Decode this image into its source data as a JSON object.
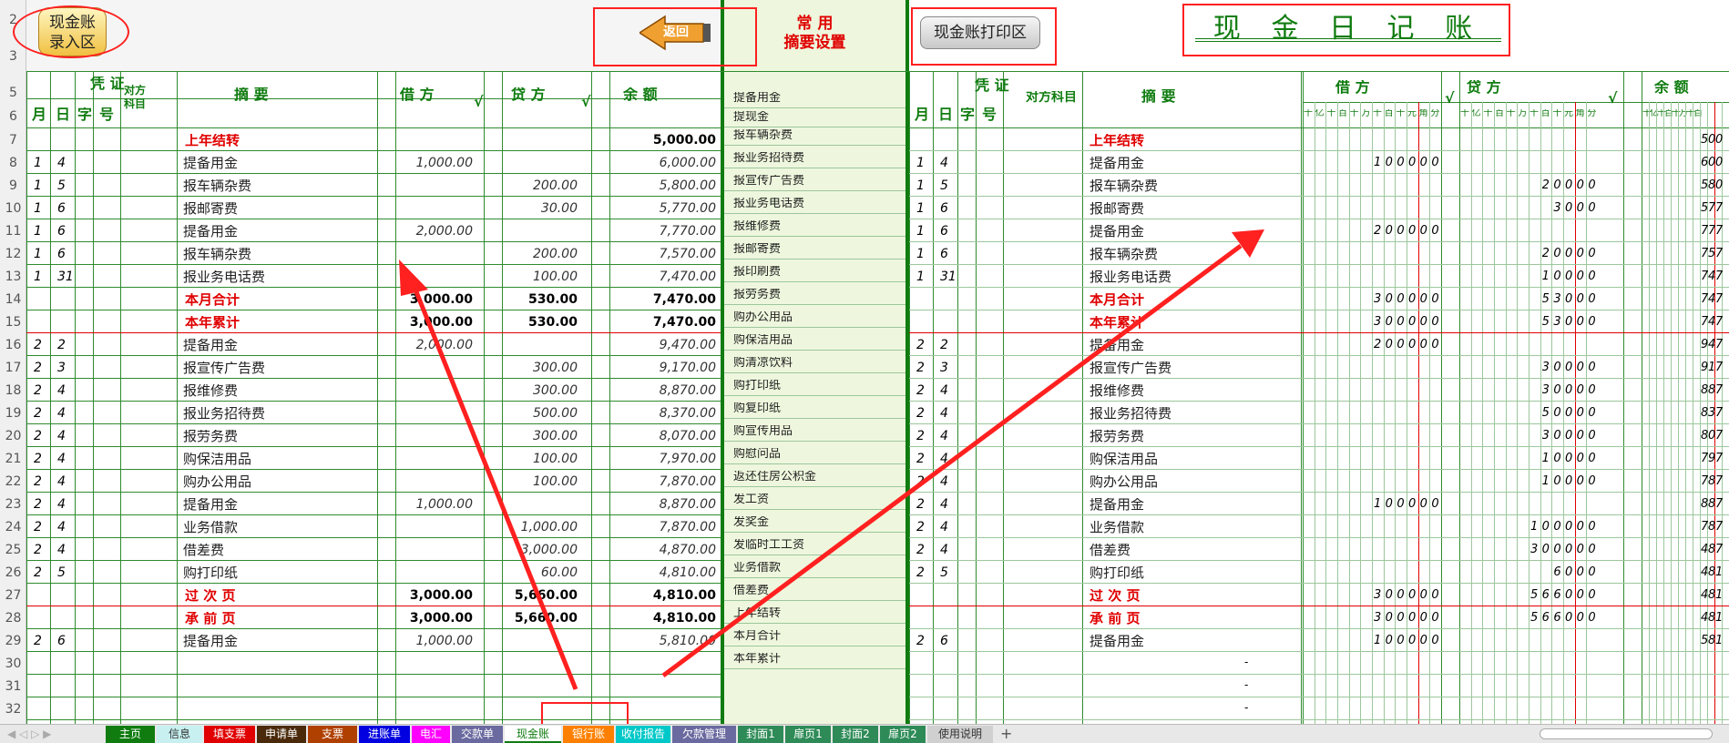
{
  "buttons": {
    "entry_line1": "现金账",
    "entry_line2": "录入区",
    "back": "返回",
    "print": "现金账打印区"
  },
  "mid_header": {
    "line1": "常 用",
    "line2": "摘要设置"
  },
  "journal_title": "现 金 日 记 账",
  "left_header": {
    "voucher": "凭 证",
    "month": "月",
    "day": "日",
    "zi": "字",
    "hao": "号",
    "account_l1": "对方",
    "account_l2": "科目",
    "summary": "摘 要",
    "debit": "借 方",
    "check": "√",
    "credit": "贷 方",
    "balance": "余 额"
  },
  "right_header": {
    "voucher": "凭 证",
    "month": "月",
    "day": "日",
    "zi": "字",
    "hao": "号",
    "account": "对方科目",
    "summary": "摘 要",
    "debit": "借 方",
    "check": "√",
    "credit": "贷 方",
    "balance": "余 额"
  },
  "digit_units": [
    "十",
    "亿",
    "千",
    "百",
    "十",
    "万",
    "千",
    "百",
    "十",
    "元",
    "角",
    "分"
  ],
  "row_numbers": [
    "2",
    "3",
    "5",
    "6",
    "7",
    "8",
    "9",
    "10",
    "11",
    "12",
    "13",
    "14",
    "15",
    "16",
    "17",
    "18",
    "19",
    "20",
    "21",
    "22",
    "23",
    "24",
    "25",
    "26",
    "27",
    "28",
    "29",
    "30",
    "31",
    "32"
  ],
  "rows": [
    {
      "m": "",
      "d": "",
      "sum": "上年结转",
      "dr": "",
      "cr": "",
      "bal": "5,000.00",
      "red": true,
      "rdr": "",
      "rcr": "",
      "rbal": "500"
    },
    {
      "m": "1",
      "d": "4",
      "sum": "提备用金",
      "dr": "1,000.00",
      "cr": "",
      "bal": "6,000.00",
      "red": false,
      "rdr": "100000",
      "rcr": "",
      "rbal": "600"
    },
    {
      "m": "1",
      "d": "5",
      "sum": "报车辆杂费",
      "dr": "",
      "cr": "200.00",
      "bal": "5,800.00",
      "red": false,
      "rdr": "",
      "rcr": "20000",
      "rbal": "580"
    },
    {
      "m": "1",
      "d": "6",
      "sum": "报邮寄费",
      "dr": "",
      "cr": "30.00",
      "bal": "5,770.00",
      "red": false,
      "rdr": "",
      "rcr": "3000",
      "rbal": "577"
    },
    {
      "m": "1",
      "d": "6",
      "sum": "提备用金",
      "dr": "2,000.00",
      "cr": "",
      "bal": "7,770.00",
      "red": false,
      "rdr": "200000",
      "rcr": "",
      "rbal": "777"
    },
    {
      "m": "1",
      "d": "6",
      "sum": "报车辆杂费",
      "dr": "",
      "cr": "200.00",
      "bal": "7,570.00",
      "red": false,
      "rdr": "",
      "rcr": "20000",
      "rbal": "757"
    },
    {
      "m": "1",
      "d": "31",
      "sum": "报业务电话费",
      "dr": "",
      "cr": "100.00",
      "bal": "7,470.00",
      "red": false,
      "rdr": "",
      "rcr": "10000",
      "rbal": "747"
    },
    {
      "m": "",
      "d": "",
      "sum": "本月合计",
      "dr": "3,000.00",
      "cr": "530.00",
      "bal": "7,470.00",
      "red": true,
      "rdr": "300000",
      "rcr": "53000",
      "rbal": "747"
    },
    {
      "m": "",
      "d": "",
      "sum": "本年累计",
      "dr": "3,000.00",
      "cr": "530.00",
      "bal": "7,470.00",
      "red": true,
      "rdr": "300000",
      "rcr": "53000",
      "rbal": "747"
    },
    {
      "m": "2",
      "d": "2",
      "sum": "提备用金",
      "dr": "2,000.00",
      "cr": "",
      "bal": "9,470.00",
      "red": false,
      "rdr": "200000",
      "rcr": "",
      "rbal": "947"
    },
    {
      "m": "2",
      "d": "3",
      "sum": "报宣传广告费",
      "dr": "",
      "cr": "300.00",
      "bal": "9,170.00",
      "red": false,
      "rdr": "",
      "rcr": "30000",
      "rbal": "917"
    },
    {
      "m": "2",
      "d": "4",
      "sum": "报维修费",
      "dr": "",
      "cr": "300.00",
      "bal": "8,870.00",
      "red": false,
      "rdr": "",
      "rcr": "30000",
      "rbal": "887"
    },
    {
      "m": "2",
      "d": "4",
      "sum": "报业务招待费",
      "dr": "",
      "cr": "500.00",
      "bal": "8,370.00",
      "red": false,
      "rdr": "",
      "rcr": "50000",
      "rbal": "837"
    },
    {
      "m": "2",
      "d": "4",
      "sum": "报劳务费",
      "dr": "",
      "cr": "300.00",
      "bal": "8,070.00",
      "red": false,
      "rdr": "",
      "rcr": "30000",
      "rbal": "807"
    },
    {
      "m": "2",
      "d": "4",
      "sum": "购保洁用品",
      "dr": "",
      "cr": "100.00",
      "bal": "7,970.00",
      "red": false,
      "rdr": "",
      "rcr": "10000",
      "rbal": "797"
    },
    {
      "m": "2",
      "d": "4",
      "sum": "购办公用品",
      "dr": "",
      "cr": "100.00",
      "bal": "7,870.00",
      "red": false,
      "rdr": "",
      "rcr": "10000",
      "rbal": "787"
    },
    {
      "m": "2",
      "d": "4",
      "sum": "提备用金",
      "dr": "1,000.00",
      "cr": "",
      "bal": "8,870.00",
      "red": false,
      "rdr": "100000",
      "rcr": "",
      "rbal": "887"
    },
    {
      "m": "2",
      "d": "4",
      "sum": "业务借款",
      "dr": "",
      "cr": "1,000.00",
      "bal": "7,870.00",
      "red": false,
      "rdr": "",
      "rcr": "100000",
      "rbal": "787"
    },
    {
      "m": "2",
      "d": "4",
      "sum": "借差费",
      "dr": "",
      "cr": "3,000.00",
      "bal": "4,870.00",
      "red": false,
      "rdr": "",
      "rcr": "300000",
      "rbal": "487"
    },
    {
      "m": "2",
      "d": "5",
      "sum": "购打印纸",
      "dr": "",
      "cr": "60.00",
      "bal": "4,810.00",
      "red": false,
      "rdr": "",
      "rcr": "6000",
      "rbal": "481"
    },
    {
      "m": "",
      "d": "",
      "sum": "过 次 页",
      "dr": "3,000.00",
      "cr": "5,660.00",
      "bal": "4,810.00",
      "red": true,
      "rdr": "300000",
      "rcr": "566000",
      "rbal": "481"
    },
    {
      "m": "",
      "d": "",
      "sum": "承 前 页",
      "dr": "3,000.00",
      "cr": "5,660.00",
      "bal": "4,810.00",
      "red": true,
      "rdr": "300000",
      "rcr": "566000",
      "rbal": "481"
    },
    {
      "m": "2",
      "d": "6",
      "sum": "提备用金",
      "dr": "1,000.00",
      "cr": "",
      "bal": "5,810.00",
      "red": false,
      "rdr": "100000",
      "rcr": "",
      "rbal": "581"
    },
    {
      "m": "",
      "d": "",
      "sum": "",
      "dr": "",
      "cr": "",
      "bal": "",
      "red": false,
      "rdr": "",
      "rcr": "",
      "rbal": "-"
    },
    {
      "m": "",
      "d": "",
      "sum": "",
      "dr": "",
      "cr": "",
      "bal": "",
      "red": false,
      "rdr": "",
      "rcr": "",
      "rbal": "-"
    },
    {
      "m": "",
      "d": "",
      "sum": "",
      "dr": "",
      "cr": "",
      "bal": "",
      "red": false,
      "rdr": "",
      "rcr": "",
      "rbal": "-"
    }
  ],
  "summaries": [
    "提备用金",
    "提现金",
    "报车辆杂费",
    "报业务招待费",
    "报宣传广告费",
    "报业务电话费",
    "报维修费",
    "报邮寄费",
    "报印刷费",
    "报劳务费",
    "购办公用品",
    "购保洁用品",
    "购清凉饮料",
    "购打印纸",
    "购复印纸",
    "购宣传用品",
    "购慰问品",
    "返还住房公积金",
    "发工资",
    "发奖金",
    "发临时工工资",
    "业务借款",
    "借差费",
    "上年结转",
    "本月合计",
    "本年累计"
  ],
  "tabs": [
    {
      "label": "主页",
      "bg": "#107c10",
      "fg": "#ffffff"
    },
    {
      "label": "信息",
      "bg": "#c8f0f0",
      "fg": "#333333"
    },
    {
      "label": "填支票",
      "bg": "#e00000",
      "fg": "#ffffff"
    },
    {
      "label": "申请单",
      "bg": "#4a2a0a",
      "fg": "#ffffff"
    },
    {
      "label": "支票",
      "bg": "#b04000",
      "fg": "#ffffff"
    },
    {
      "label": "进账单",
      "bg": "#0000e0",
      "fg": "#ffffff"
    },
    {
      "label": "电汇",
      "bg": "#ff00ff",
      "fg": "#ffffff"
    },
    {
      "label": "交款单",
      "bg": "#6a6aa0",
      "fg": "#ffffff"
    },
    {
      "label": "现金账",
      "bg": "#ffffff",
      "fg": "#107c10"
    },
    {
      "label": "银行账",
      "bg": "#ff8000",
      "fg": "#ffffff"
    },
    {
      "label": "收付报告",
      "bg": "#00c8c8",
      "fg": "#ffffff"
    },
    {
      "label": "欠款管理",
      "bg": "#6a6aa0",
      "fg": "#ffffff"
    },
    {
      "label": "封面1",
      "bg": "#2e8b57",
      "fg": "#ffffff"
    },
    {
      "label": "扉页1",
      "bg": "#2e8b57",
      "fg": "#ffffff"
    },
    {
      "label": "封面2",
      "bg": "#2e8b57",
      "fg": "#ffffff"
    },
    {
      "label": "扉页2",
      "bg": "#2e8b57",
      "fg": "#ffffff"
    },
    {
      "label": "使用说明",
      "bg": "#d0d0d0",
      "fg": "#333333"
    }
  ],
  "add_sheet": "+",
  "colors": {
    "grid": "#2e8b2e",
    "red": "#e00000",
    "mid_bg": "#eef7dd",
    "annotation": "#ff2020"
  }
}
